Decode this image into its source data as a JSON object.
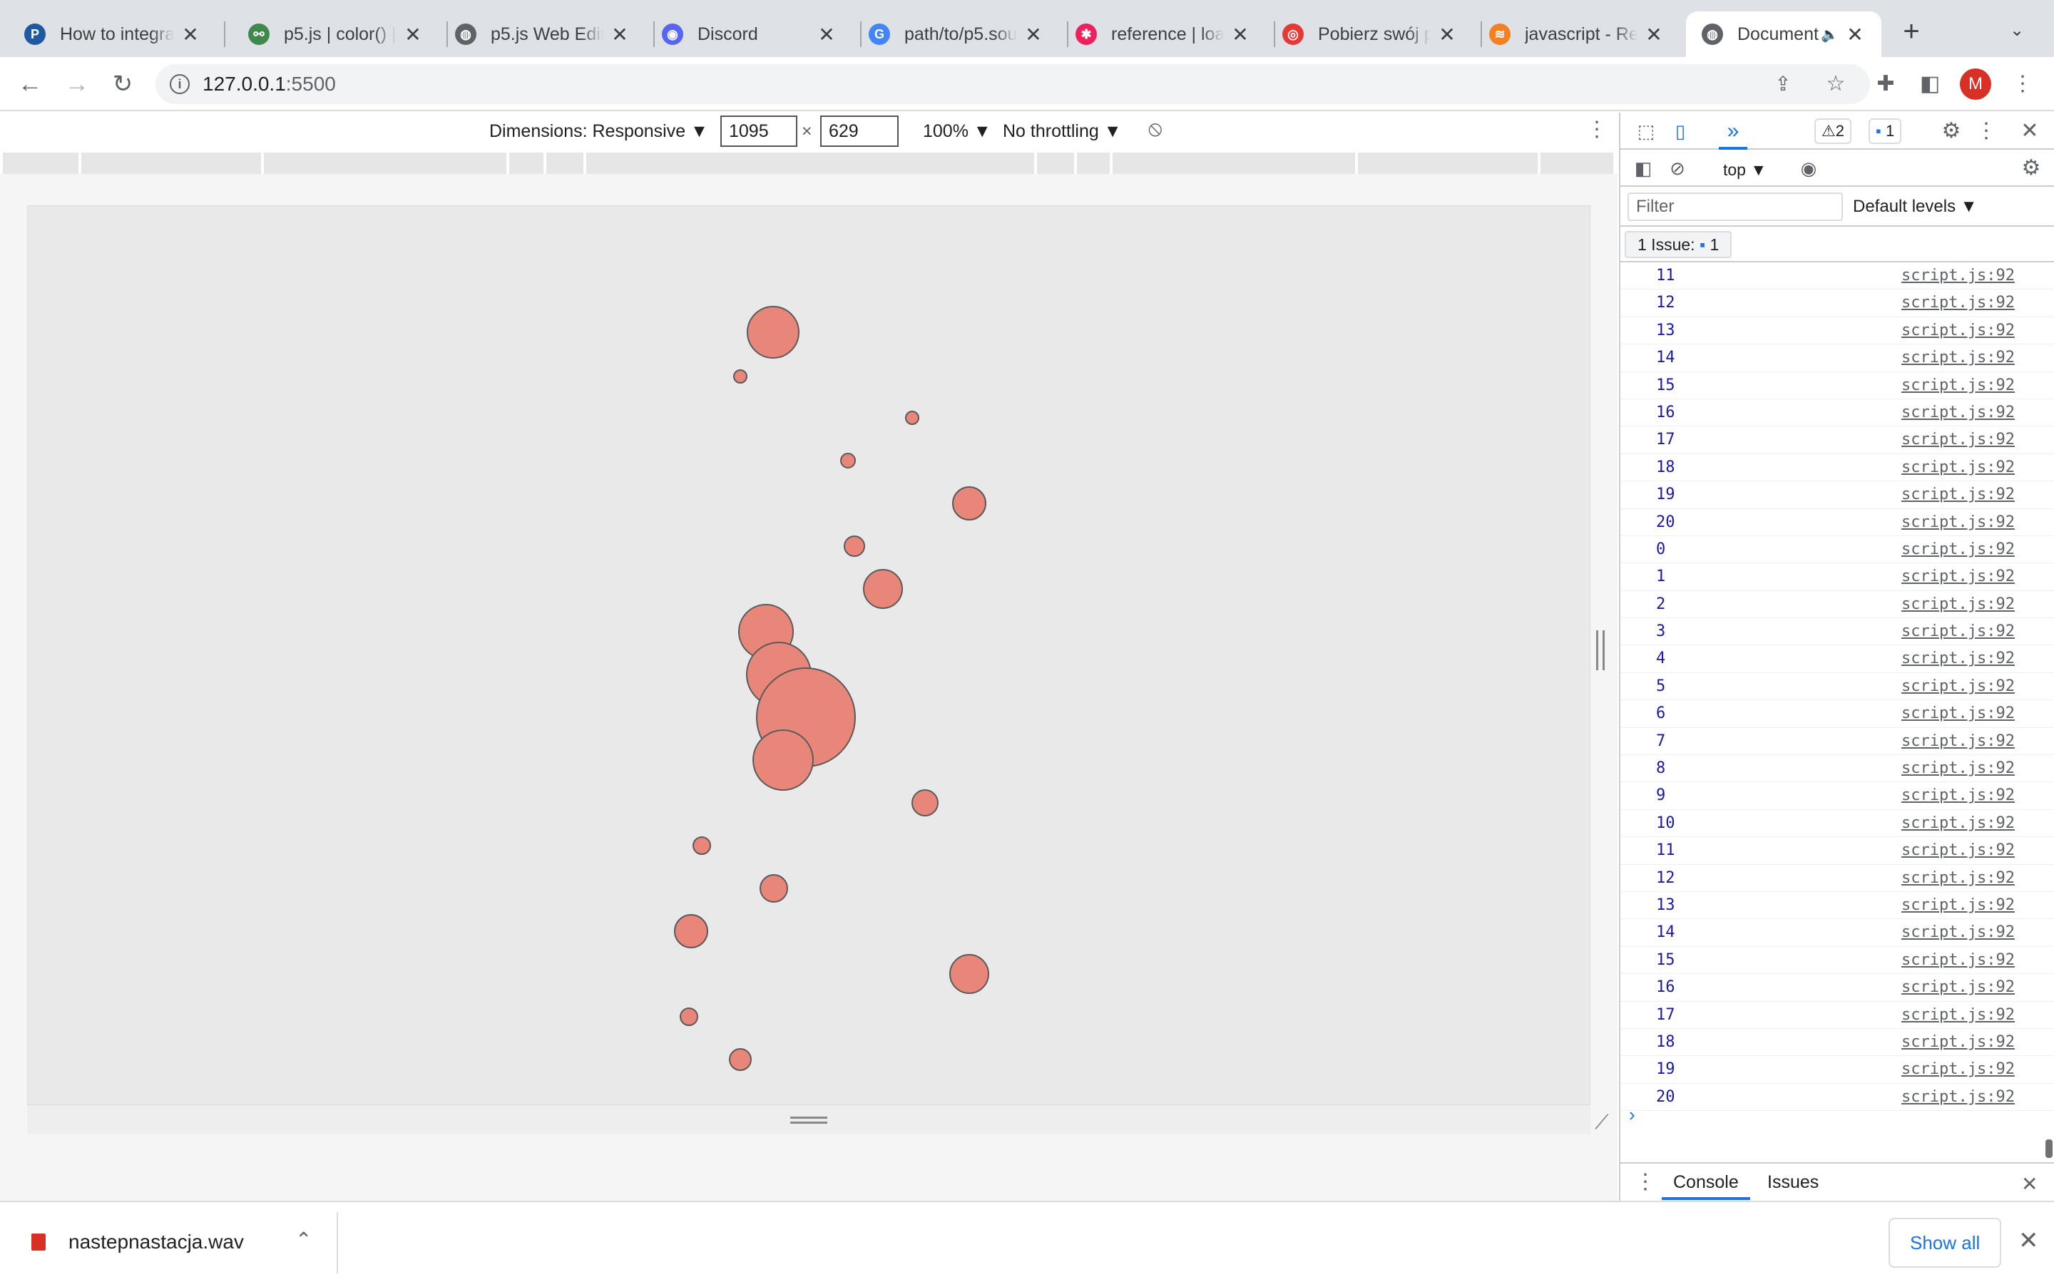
{
  "tabs": [
    {
      "title": "How to integra",
      "icon": "pinterest-icon",
      "color": "#1e5aa0",
      "glyph": "P"
    },
    {
      "title": "p5.js | color() |",
      "icon": "p5-icon",
      "color": "#3f8a4a",
      "glyph": "⚯"
    },
    {
      "title": "p5.js Web Edit",
      "icon": "globe-icon",
      "color": "#5f6368",
      "glyph": "◍"
    },
    {
      "title": "Discord",
      "icon": "discord-icon",
      "color": "#5865f2",
      "glyph": "◉"
    },
    {
      "title": "path/to/p5.sou",
      "icon": "google-icon",
      "color": "#4285f4",
      "glyph": "G"
    },
    {
      "title": "reference | loa",
      "icon": "asterisk-icon",
      "color": "#ed225d",
      "glyph": "✱"
    },
    {
      "title": "Pobierz swój p",
      "icon": "download-site-icon",
      "color": "#e53935",
      "glyph": "◎"
    },
    {
      "title": "javascript - Re",
      "icon": "stackoverflow-icon",
      "color": "#f48024",
      "glyph": "≋"
    },
    {
      "title": "Document",
      "icon": "globe-icon",
      "color": "#5f6368",
      "glyph": "◍",
      "active": true
    }
  ],
  "toolbar": {
    "url_host": "127.0.0.1",
    "url_port": ":5500",
    "profile_initial": "M"
  },
  "device": {
    "dimensions_label": "Dimensions: Responsive ▼",
    "width": "1095",
    "height": "629",
    "times": "×",
    "zoom": "100% ▼",
    "throttling": "No throttling ▼"
  },
  "canvas": {
    "circle_fill": "#e8867a",
    "circle_stroke": "#5a5a5a",
    "background": "#e9e9e9",
    "circle_count": 20
  },
  "devtools": {
    "warnings_badge": "⚠2",
    "messages_badge": "1",
    "context": "top ▼",
    "filter_placeholder": "Filter",
    "levels": "Default levels ▼",
    "issues_label": "1 Issue:",
    "issues_count": "1",
    "log_source": "script.js:92",
    "log_values": [
      "11",
      "12",
      "13",
      "14",
      "15",
      "16",
      "17",
      "18",
      "19",
      "20",
      "0",
      "1",
      "2",
      "3",
      "4",
      "5",
      "6",
      "7",
      "8",
      "9",
      "10",
      "11",
      "12",
      "13",
      "14",
      "15",
      "16",
      "17",
      "18",
      "19",
      "20"
    ],
    "drawer_console": "Console",
    "drawer_issues": "Issues"
  },
  "download": {
    "filename": "nastepnastacja.wav",
    "show_all": "Show all"
  }
}
